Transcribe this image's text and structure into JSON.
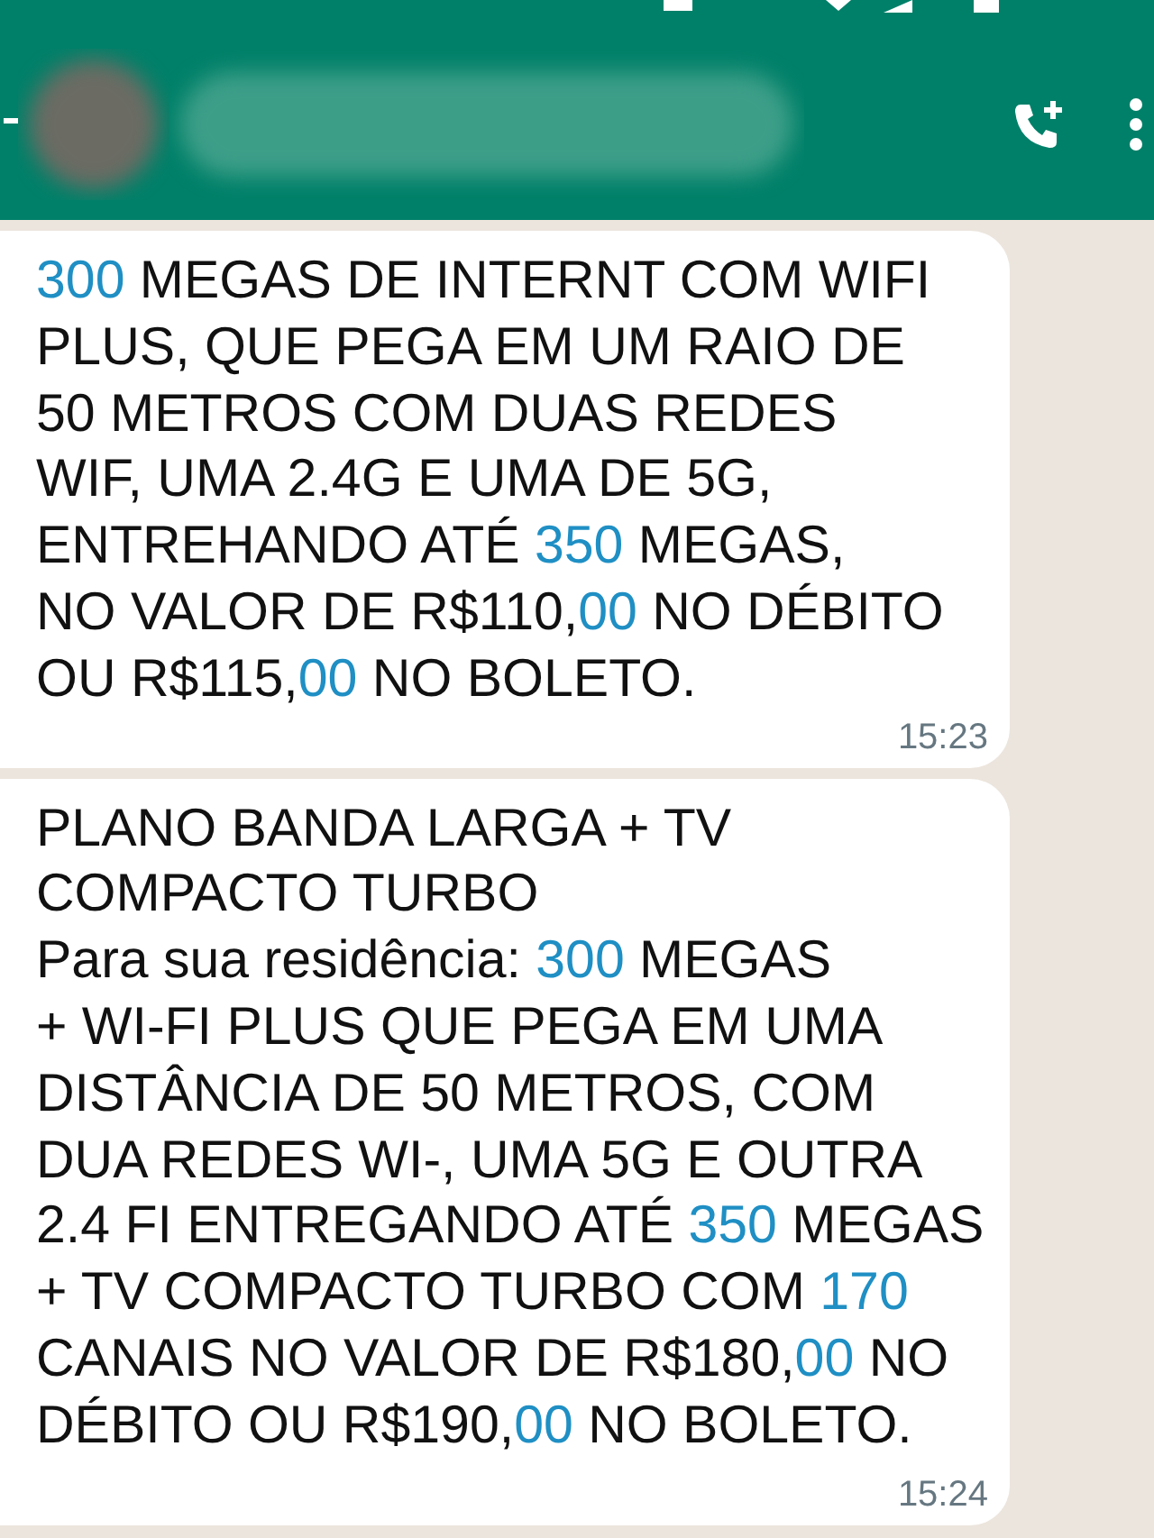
{
  "header": {
    "contact": {
      "redacted": true
    }
  },
  "messages": [
    {
      "time": "15:23",
      "lines": [
        [
          {
            "kind": "link",
            "text": "300"
          },
          {
            "kind": "plain",
            "text": " MEGAS DE INTERNT COM WIFI"
          }
        ],
        [
          {
            "kind": "plain",
            "text": "PLUS, QUE PEGA EM UM RAIO DE"
          }
        ],
        [
          {
            "kind": "plain",
            "text": "50 METROS COM DUAS REDES"
          }
        ],
        [
          {
            "kind": "plain",
            "text": "WIF, UMA 2.4G E UMA DE 5G,"
          }
        ],
        [
          {
            "kind": "plain",
            "text": "ENTREHANDO ATÉ "
          },
          {
            "kind": "link",
            "text": "350"
          },
          {
            "kind": "plain",
            "text": " MEGAS,"
          }
        ],
        [
          {
            "kind": "plain",
            "text": "NO VALOR DE R$110,"
          },
          {
            "kind": "link",
            "text": "00"
          },
          {
            "kind": "plain",
            "text": " NO DÉBITO"
          }
        ],
        [
          {
            "kind": "plain",
            "text": "OU R$115,"
          },
          {
            "kind": "link",
            "text": "00"
          },
          {
            "kind": "plain",
            "text": " NO BOLETO."
          }
        ]
      ]
    },
    {
      "time": "15:24",
      "lines": [
        [
          {
            "kind": "plain",
            "text": "PLANO BANDA LARGA + TV"
          }
        ],
        [
          {
            "kind": "plain",
            "text": "COMPACTO TURBO"
          }
        ],
        [
          {
            "kind": "plain",
            "text": "Para sua residência:  "
          },
          {
            "kind": "link",
            "text": "300"
          },
          {
            "kind": "plain",
            "text": " MEGAS"
          }
        ],
        [
          {
            "kind": "plain",
            "text": "+ WI-FI PLUS QUE PEGA EM UMA"
          }
        ],
        [
          {
            "kind": "plain",
            "text": "DISTÂNCIA DE 50 METROS, COM"
          }
        ],
        [
          {
            "kind": "plain",
            "text": "DUA REDES WI-, UMA 5G E OUTRA"
          }
        ],
        [
          {
            "kind": "plain",
            "text": "2.4 FI ENTREGANDO ATÉ "
          },
          {
            "kind": "link",
            "text": "350"
          },
          {
            "kind": "plain",
            "text": " MEGAS"
          }
        ],
        [
          {
            "kind": "plain",
            "text": "+ TV COMPACTO TURBO COM "
          },
          {
            "kind": "link",
            "text": "170"
          }
        ],
        [
          {
            "kind": "plain",
            "text": "CANAIS NO VALOR DE R$180,"
          },
          {
            "kind": "link",
            "text": "00"
          },
          {
            "kind": "plain",
            "text": " NO"
          }
        ],
        [
          {
            "kind": "plain",
            "text": "DÉBITO OU R$190,"
          },
          {
            "kind": "link",
            "text": "00"
          },
          {
            "kind": "plain",
            "text": " NO BOLETO."
          }
        ]
      ]
    }
  ]
}
